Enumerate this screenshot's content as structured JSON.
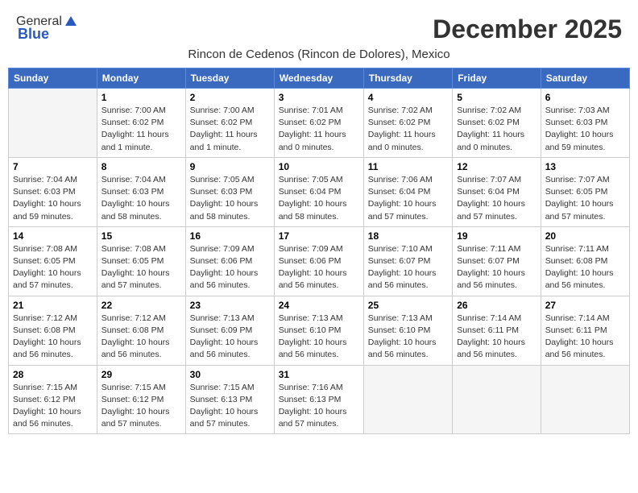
{
  "header": {
    "logo_general": "General",
    "logo_blue": "Blue",
    "month_title": "December 2025",
    "location": "Rincon de Cedenos (Rincon de Dolores), Mexico"
  },
  "weekdays": [
    "Sunday",
    "Monday",
    "Tuesday",
    "Wednesday",
    "Thursday",
    "Friday",
    "Saturday"
  ],
  "weeks": [
    [
      {
        "day": "",
        "info": ""
      },
      {
        "day": "1",
        "info": "Sunrise: 7:00 AM\nSunset: 6:02 PM\nDaylight: 11 hours\nand 1 minute."
      },
      {
        "day": "2",
        "info": "Sunrise: 7:00 AM\nSunset: 6:02 PM\nDaylight: 11 hours\nand 1 minute."
      },
      {
        "day": "3",
        "info": "Sunrise: 7:01 AM\nSunset: 6:02 PM\nDaylight: 11 hours\nand 0 minutes."
      },
      {
        "day": "4",
        "info": "Sunrise: 7:02 AM\nSunset: 6:02 PM\nDaylight: 11 hours\nand 0 minutes."
      },
      {
        "day": "5",
        "info": "Sunrise: 7:02 AM\nSunset: 6:02 PM\nDaylight: 11 hours\nand 0 minutes."
      },
      {
        "day": "6",
        "info": "Sunrise: 7:03 AM\nSunset: 6:03 PM\nDaylight: 10 hours\nand 59 minutes."
      }
    ],
    [
      {
        "day": "7",
        "info": "Sunrise: 7:04 AM\nSunset: 6:03 PM\nDaylight: 10 hours\nand 59 minutes."
      },
      {
        "day": "8",
        "info": "Sunrise: 7:04 AM\nSunset: 6:03 PM\nDaylight: 10 hours\nand 58 minutes."
      },
      {
        "day": "9",
        "info": "Sunrise: 7:05 AM\nSunset: 6:03 PM\nDaylight: 10 hours\nand 58 minutes."
      },
      {
        "day": "10",
        "info": "Sunrise: 7:05 AM\nSunset: 6:04 PM\nDaylight: 10 hours\nand 58 minutes."
      },
      {
        "day": "11",
        "info": "Sunrise: 7:06 AM\nSunset: 6:04 PM\nDaylight: 10 hours\nand 57 minutes."
      },
      {
        "day": "12",
        "info": "Sunrise: 7:07 AM\nSunset: 6:04 PM\nDaylight: 10 hours\nand 57 minutes."
      },
      {
        "day": "13",
        "info": "Sunrise: 7:07 AM\nSunset: 6:05 PM\nDaylight: 10 hours\nand 57 minutes."
      }
    ],
    [
      {
        "day": "14",
        "info": "Sunrise: 7:08 AM\nSunset: 6:05 PM\nDaylight: 10 hours\nand 57 minutes."
      },
      {
        "day": "15",
        "info": "Sunrise: 7:08 AM\nSunset: 6:05 PM\nDaylight: 10 hours\nand 57 minutes."
      },
      {
        "day": "16",
        "info": "Sunrise: 7:09 AM\nSunset: 6:06 PM\nDaylight: 10 hours\nand 56 minutes."
      },
      {
        "day": "17",
        "info": "Sunrise: 7:09 AM\nSunset: 6:06 PM\nDaylight: 10 hours\nand 56 minutes."
      },
      {
        "day": "18",
        "info": "Sunrise: 7:10 AM\nSunset: 6:07 PM\nDaylight: 10 hours\nand 56 minutes."
      },
      {
        "day": "19",
        "info": "Sunrise: 7:11 AM\nSunset: 6:07 PM\nDaylight: 10 hours\nand 56 minutes."
      },
      {
        "day": "20",
        "info": "Sunrise: 7:11 AM\nSunset: 6:08 PM\nDaylight: 10 hours\nand 56 minutes."
      }
    ],
    [
      {
        "day": "21",
        "info": "Sunrise: 7:12 AM\nSunset: 6:08 PM\nDaylight: 10 hours\nand 56 minutes."
      },
      {
        "day": "22",
        "info": "Sunrise: 7:12 AM\nSunset: 6:08 PM\nDaylight: 10 hours\nand 56 minutes."
      },
      {
        "day": "23",
        "info": "Sunrise: 7:13 AM\nSunset: 6:09 PM\nDaylight: 10 hours\nand 56 minutes."
      },
      {
        "day": "24",
        "info": "Sunrise: 7:13 AM\nSunset: 6:10 PM\nDaylight: 10 hours\nand 56 minutes."
      },
      {
        "day": "25",
        "info": "Sunrise: 7:13 AM\nSunset: 6:10 PM\nDaylight: 10 hours\nand 56 minutes."
      },
      {
        "day": "26",
        "info": "Sunrise: 7:14 AM\nSunset: 6:11 PM\nDaylight: 10 hours\nand 56 minutes."
      },
      {
        "day": "27",
        "info": "Sunrise: 7:14 AM\nSunset: 6:11 PM\nDaylight: 10 hours\nand 56 minutes."
      }
    ],
    [
      {
        "day": "28",
        "info": "Sunrise: 7:15 AM\nSunset: 6:12 PM\nDaylight: 10 hours\nand 56 minutes."
      },
      {
        "day": "29",
        "info": "Sunrise: 7:15 AM\nSunset: 6:12 PM\nDaylight: 10 hours\nand 57 minutes."
      },
      {
        "day": "30",
        "info": "Sunrise: 7:15 AM\nSunset: 6:13 PM\nDaylight: 10 hours\nand 57 minutes."
      },
      {
        "day": "31",
        "info": "Sunrise: 7:16 AM\nSunset: 6:13 PM\nDaylight: 10 hours\nand 57 minutes."
      },
      {
        "day": "",
        "info": ""
      },
      {
        "day": "",
        "info": ""
      },
      {
        "day": "",
        "info": ""
      }
    ]
  ]
}
